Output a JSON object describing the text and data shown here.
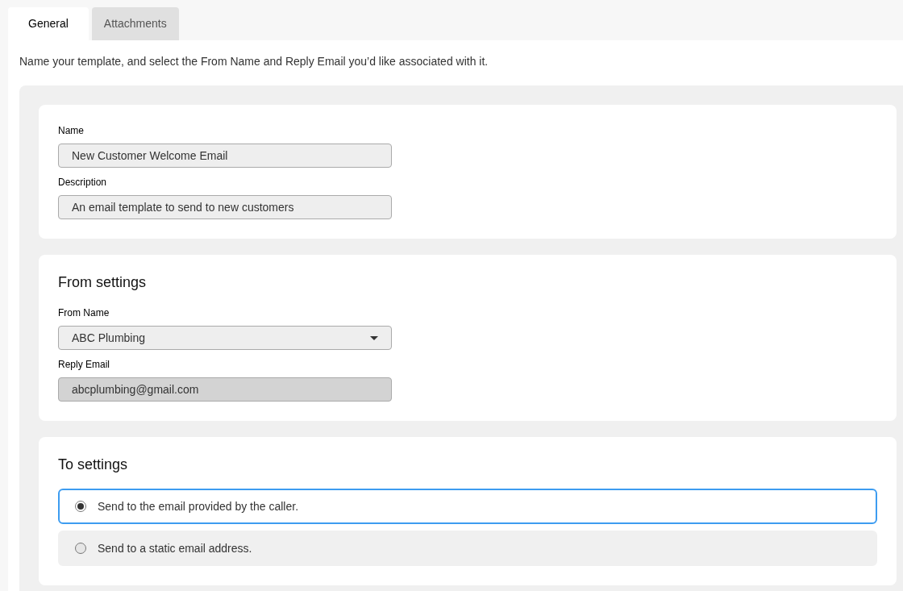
{
  "tabs": [
    {
      "label": "General",
      "selected": true
    },
    {
      "label": "Attachments",
      "selected": false
    }
  ],
  "intro": "Name your template, and select the From Name and Reply Email you’d like associated with it.",
  "sections": [
    {
      "fields": [
        {
          "kind": "text",
          "label": "Name",
          "value": "New Customer Welcome Email",
          "disabled": false
        },
        {
          "kind": "text",
          "label": "Description",
          "value": "An email template to send to new customers",
          "disabled": false
        }
      ]
    },
    {
      "title": "From settings",
      "fields": [
        {
          "kind": "select",
          "label": "From Name",
          "value": "ABC Plumbing",
          "disabled": false
        },
        {
          "kind": "text",
          "label": "Reply Email",
          "value": "abcplumbing@gmail.com",
          "disabled": true
        }
      ]
    },
    {
      "title": "To settings",
      "options": [
        {
          "label": "Send to the email provided by the caller.",
          "selected": true
        },
        {
          "label": "Send to a static email address.",
          "selected": false
        }
      ]
    }
  ]
}
